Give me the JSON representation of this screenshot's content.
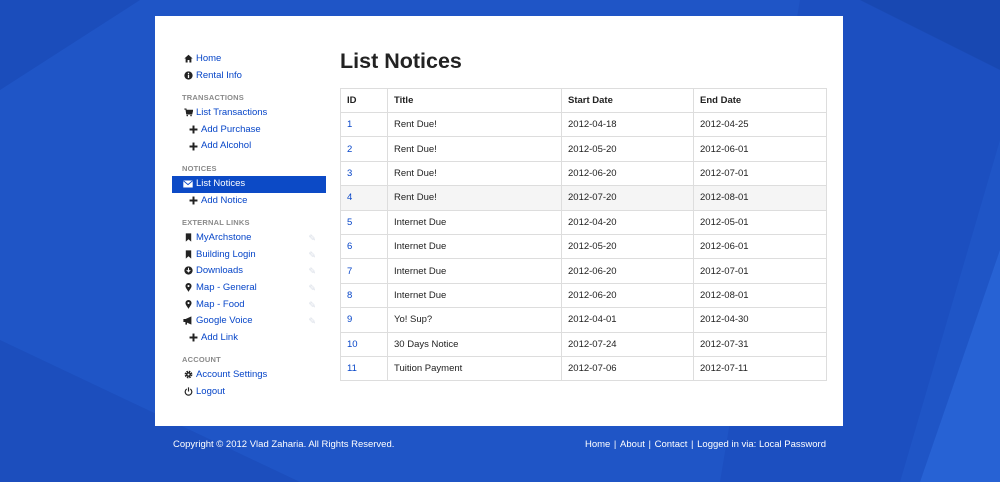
{
  "sidebar": {
    "top_items": [
      {
        "label": "Home",
        "icon": "home-icon"
      },
      {
        "label": "Rental Info",
        "icon": "info-icon"
      }
    ],
    "transactions": {
      "header": "TRANSACTIONS",
      "items": [
        {
          "label": "List Transactions",
          "icon": "cart-icon"
        },
        {
          "label": "Add Purchase",
          "icon": "plus-icon"
        },
        {
          "label": "Add Alcohol",
          "icon": "plus-icon"
        }
      ]
    },
    "notices": {
      "header": "NOTICES",
      "items": [
        {
          "label": "List Notices",
          "icon": "envelope-icon",
          "active": true
        },
        {
          "label": "Add Notice",
          "icon": "plus-icon"
        }
      ]
    },
    "external_links": {
      "header": "EXTERNAL LINKS",
      "items": [
        {
          "label": "MyArchstone",
          "icon": "bookmark-icon"
        },
        {
          "label": "Building Login",
          "icon": "bookmark-icon"
        },
        {
          "label": "Downloads",
          "icon": "download-circle-icon"
        },
        {
          "label": "Map - General",
          "icon": "map-marker-icon"
        },
        {
          "label": "Map - Food",
          "icon": "map-marker-icon"
        },
        {
          "label": "Google Voice",
          "icon": "bullhorn-icon"
        },
        {
          "label": "Add Link",
          "icon": "plus-icon"
        }
      ]
    },
    "account": {
      "header": "ACCOUNT",
      "items": [
        {
          "label": "Account Settings",
          "icon": "cog-icon"
        },
        {
          "label": "Logout",
          "icon": "power-icon"
        }
      ]
    }
  },
  "main": {
    "title": "List Notices",
    "table": {
      "columns": [
        "ID",
        "Title",
        "Start Date",
        "End Date"
      ],
      "rows": [
        [
          "1",
          "Rent Due!",
          "2012-04-18",
          "2012-04-25"
        ],
        [
          "2",
          "Rent Due!",
          "2012-05-20",
          "2012-06-01"
        ],
        [
          "3",
          "Rent Due!",
          "2012-06-20",
          "2012-07-01"
        ],
        [
          "4",
          "Rent Due!",
          "2012-07-20",
          "2012-08-01"
        ],
        [
          "5",
          "Internet Due",
          "2012-04-20",
          "2012-05-01"
        ],
        [
          "6",
          "Internet Due",
          "2012-05-20",
          "2012-06-01"
        ],
        [
          "7",
          "Internet Due",
          "2012-06-20",
          "2012-07-01"
        ],
        [
          "8",
          "Internet Due",
          "2012-06-20",
          "2012-08-01"
        ],
        [
          "9",
          "Yo! Sup?",
          "2012-04-01",
          "2012-04-30"
        ],
        [
          "10",
          "30 Days Notice",
          "2012-07-24",
          "2012-07-31"
        ],
        [
          "11",
          "Tuition Payment",
          "2012-07-06",
          "2012-07-11"
        ]
      ]
    }
  },
  "footer": {
    "copyright": "Copyright © 2012 Vlad Zaharia. All Rights Reserved.",
    "links": [
      "Home",
      "About",
      "Contact"
    ],
    "logged_in_prefix": "Logged in via:",
    "logged_in_method": "Local Password"
  },
  "colors": {
    "background": "#1f55c6",
    "accent": "#0c4ac6",
    "link": "#0645c8"
  }
}
